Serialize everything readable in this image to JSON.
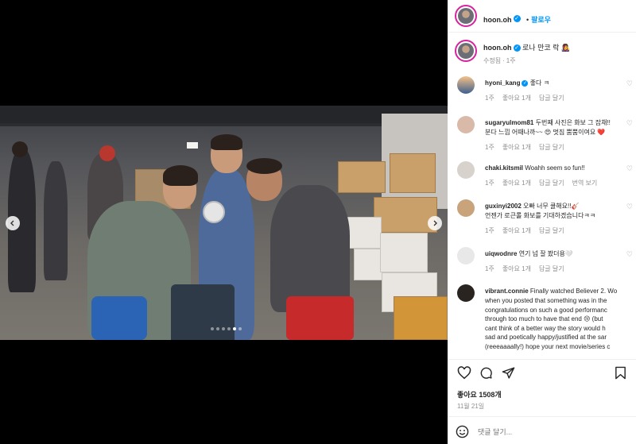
{
  "post": {
    "author": "hoon.oh",
    "follow_label": "팔로우",
    "caption": "로나 만코 락 👩‍🎤",
    "caption_edited": "수정됨",
    "caption_age": "1주",
    "likes": "좋아요 1508개",
    "date": "11월 21일",
    "comment_placeholder": "댓글 달기...",
    "media_dots": 6,
    "active_dot": 4
  },
  "labels": {
    "like": "좋아요 1개",
    "reply": "답글 달기",
    "translate": "번역 보기"
  },
  "comments": [
    {
      "user": "hyoni_kang",
      "verified": true,
      "text": "좋다 ㅋ",
      "age": "1주"
    },
    {
      "user": "sugaryulmom81",
      "verified": false,
      "text": "두번째 사진은 화보 그 잡채!!",
      "text2": "분다 느낌 어때나까~~ 😍 멋짐 뿜뿜이여요 ❤️",
      "age": "1주"
    },
    {
      "user": "chaki.kitsmil",
      "verified": false,
      "text": "Woahh seem so fun!!",
      "age": "1주"
    },
    {
      "user": "guxinyi2002",
      "verified": false,
      "text": "오빠 너무 쿨해요!!🎸",
      "text2": "언젠가 로큰롤 화보를 기대하겠습니다ㅋㅋ",
      "age": "1주"
    },
    {
      "user": "uiqwodnre",
      "verified": false,
      "text": "연기 넘 잘 봤더용🤍",
      "age": "1주"
    },
    {
      "user": "vibrant.connie",
      "verified": false,
      "text": "Finally watched Believer 2. Wo",
      "lines": [
        "when you posted that something was in the",
        "congratulations on such a good performanc",
        "through too much to have that end 😢 (but",
        "cant think of a better way the story would h",
        "sad and poetically happy/justified at the sar",
        "(reeeaaaally!) hope your next movie/series c"
      ]
    }
  ],
  "colors": {
    "link": "#0095f6",
    "muted": "#8e8e8e",
    "ring": "#d6249f"
  }
}
